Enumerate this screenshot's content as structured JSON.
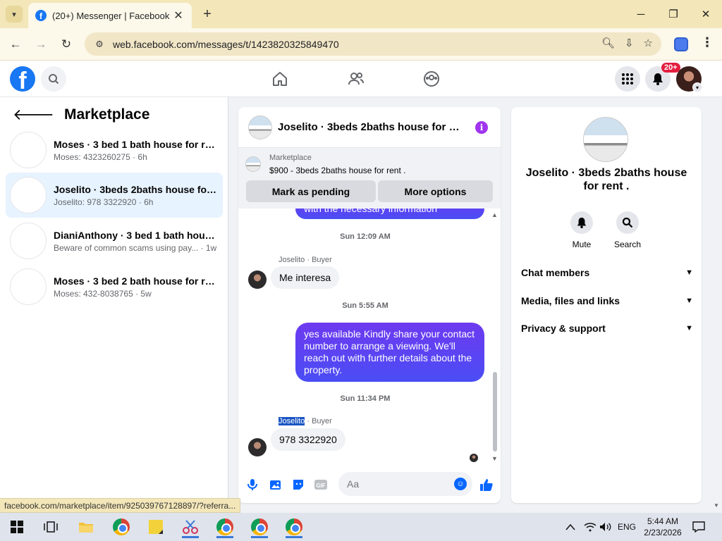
{
  "browser": {
    "tab_title": "(20+) Messenger | Facebook",
    "url": "web.facebook.com/messages/t/1423820325849470",
    "status_url": "facebook.com/marketplace/item/925039767128897/?referra..."
  },
  "fb": {
    "notification_count": "20+"
  },
  "sidebar": {
    "title": "Marketplace",
    "conversations": [
      {
        "name": "Moses · 3 bed 1 bath house for rent",
        "sub": "Moses: 4323260275 · 6h",
        "active": false
      },
      {
        "name": "Joselito · 3beds 2baths house for r...",
        "sub": "Joselito: 978 3322920 · 6h",
        "active": true
      },
      {
        "name": "DianiAnthony · 3 bed 1 bath house...",
        "sub": "Beware of common scams using pay... · 1w",
        "active": false
      },
      {
        "name": "Moses · 3 bed 2 bath house for rent",
        "sub": "Moses: 432-8038765 · 5w",
        "active": false
      }
    ]
  },
  "chat": {
    "title": "Joselito · 3beds 2baths house for re...",
    "marketplace_label": "Marketplace",
    "listing": "$900 - 3beds 2baths house for rent .",
    "mark_pending_label": "Mark as pending",
    "more_options_label": "More options",
    "messages": {
      "partial_text": "with the necessary information",
      "ts1": "Sun 12:09 AM",
      "sender1_name": "Joselito",
      "sender1_role": " · Buyer",
      "msg1": "Me interesa",
      "ts2": "Sun 5:55 AM",
      "msg2": "yes available Kindly share your contact number to arrange a viewing. We'll reach out with further details about the property.",
      "ts3": "Sun 11:34 PM",
      "sender2_name": "Joselito",
      "sender2_role": " · Buyer",
      "msg3": "978 3322920"
    },
    "input_placeholder": "Aa"
  },
  "info_panel": {
    "title": "Joselito · 3beds 2baths house for rent .",
    "mute_label": "Mute",
    "search_label": "Search",
    "sections": [
      "Chat members",
      "Media, files and links",
      "Privacy & support"
    ]
  },
  "taskbar": {
    "language": "ENG",
    "time": "5:44 AM",
    "date": "2/23/2026"
  },
  "colors": {
    "fb_blue": "#1877f2",
    "bubble_out_start": "#6e3af0",
    "bubble_out_end": "#4a4df5",
    "active_conv_bg": "#e7f3ff",
    "notif_red": "#e41e3f",
    "info_purple": "#a034f0"
  }
}
